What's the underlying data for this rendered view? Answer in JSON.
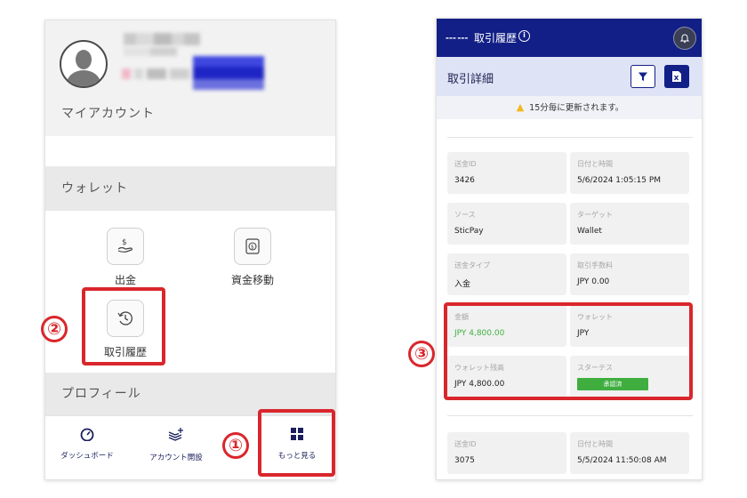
{
  "left": {
    "sections": {
      "my_account": "マイアカウント",
      "wallet": "ウォレット",
      "profile": "プロフィール"
    },
    "wallet_items": {
      "withdraw": "出金",
      "transfer": "資金移動",
      "history": "取引履歴"
    },
    "nav": {
      "dashboard": "ダッシュボード",
      "open_account": "アカウント開設",
      "more": "もっと見る"
    }
  },
  "markers": {
    "one": "①",
    "two": "②",
    "three": "③"
  },
  "right": {
    "page_title": "取引履歴",
    "info_glyph": "i",
    "sub_title": "取引詳細",
    "notice": "15分毎に更新されます。",
    "cards": [
      {
        "label": "送金ID",
        "value": "3426"
      },
      {
        "label": "日付と時間",
        "value": "5/6/2024 1:05:15 PM"
      },
      {
        "label": "ソース",
        "value": "SticPay"
      },
      {
        "label": "ターゲット",
        "value": "Wallet"
      },
      {
        "label": "送金タイプ",
        "value": "入金"
      },
      {
        "label": "取引手数料",
        "value": "JPY 0.00"
      },
      {
        "label": "金額",
        "value": "JPY 4,800.00"
      },
      {
        "label": "ウォレット",
        "value": "JPY"
      },
      {
        "label": "ウォレット残高",
        "value": "JPY 4,800.00"
      },
      {
        "label": "スターテス",
        "value": "承認済"
      },
      {
        "label": "送金ID",
        "value": "3075"
      },
      {
        "label": "日付と時間",
        "value": "5/5/2024 11:50:08 AM"
      }
    ],
    "colors": {
      "primary": "#121f86",
      "accent_green": "#3fae3f",
      "highlight_red": "#d9262c",
      "warning": "#f2b71c"
    }
  }
}
